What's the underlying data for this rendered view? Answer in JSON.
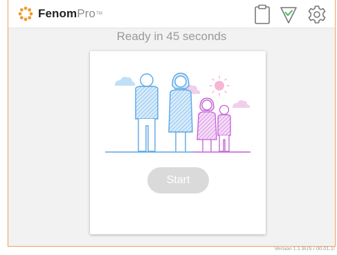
{
  "header": {
    "brand_bold": "Fenom",
    "brand_light": "Pro",
    "brand_mark": "TM",
    "icons": [
      "clipboard-icon",
      "checkmark-triangle-icon",
      "gear-icon"
    ]
  },
  "status": {
    "ready_text": "Ready in 45 seconds"
  },
  "card": {
    "illustration": "family-illustration",
    "start_label": "Start"
  },
  "footer": {
    "version": "Version 1.1.9US / 00.01.1!"
  },
  "colors": {
    "frame_border": "#f0a15c",
    "logo_orange": "#f39a2b",
    "check_green": "#3cbf5a",
    "family_blue": "#5aa6e6",
    "family_pink": "#c45cd6",
    "cloud_blue": "#bfe0f7",
    "cloud_pink": "#efcfe9",
    "sun_pink": "#f6b6d4",
    "start_disabled": "#dadada"
  }
}
